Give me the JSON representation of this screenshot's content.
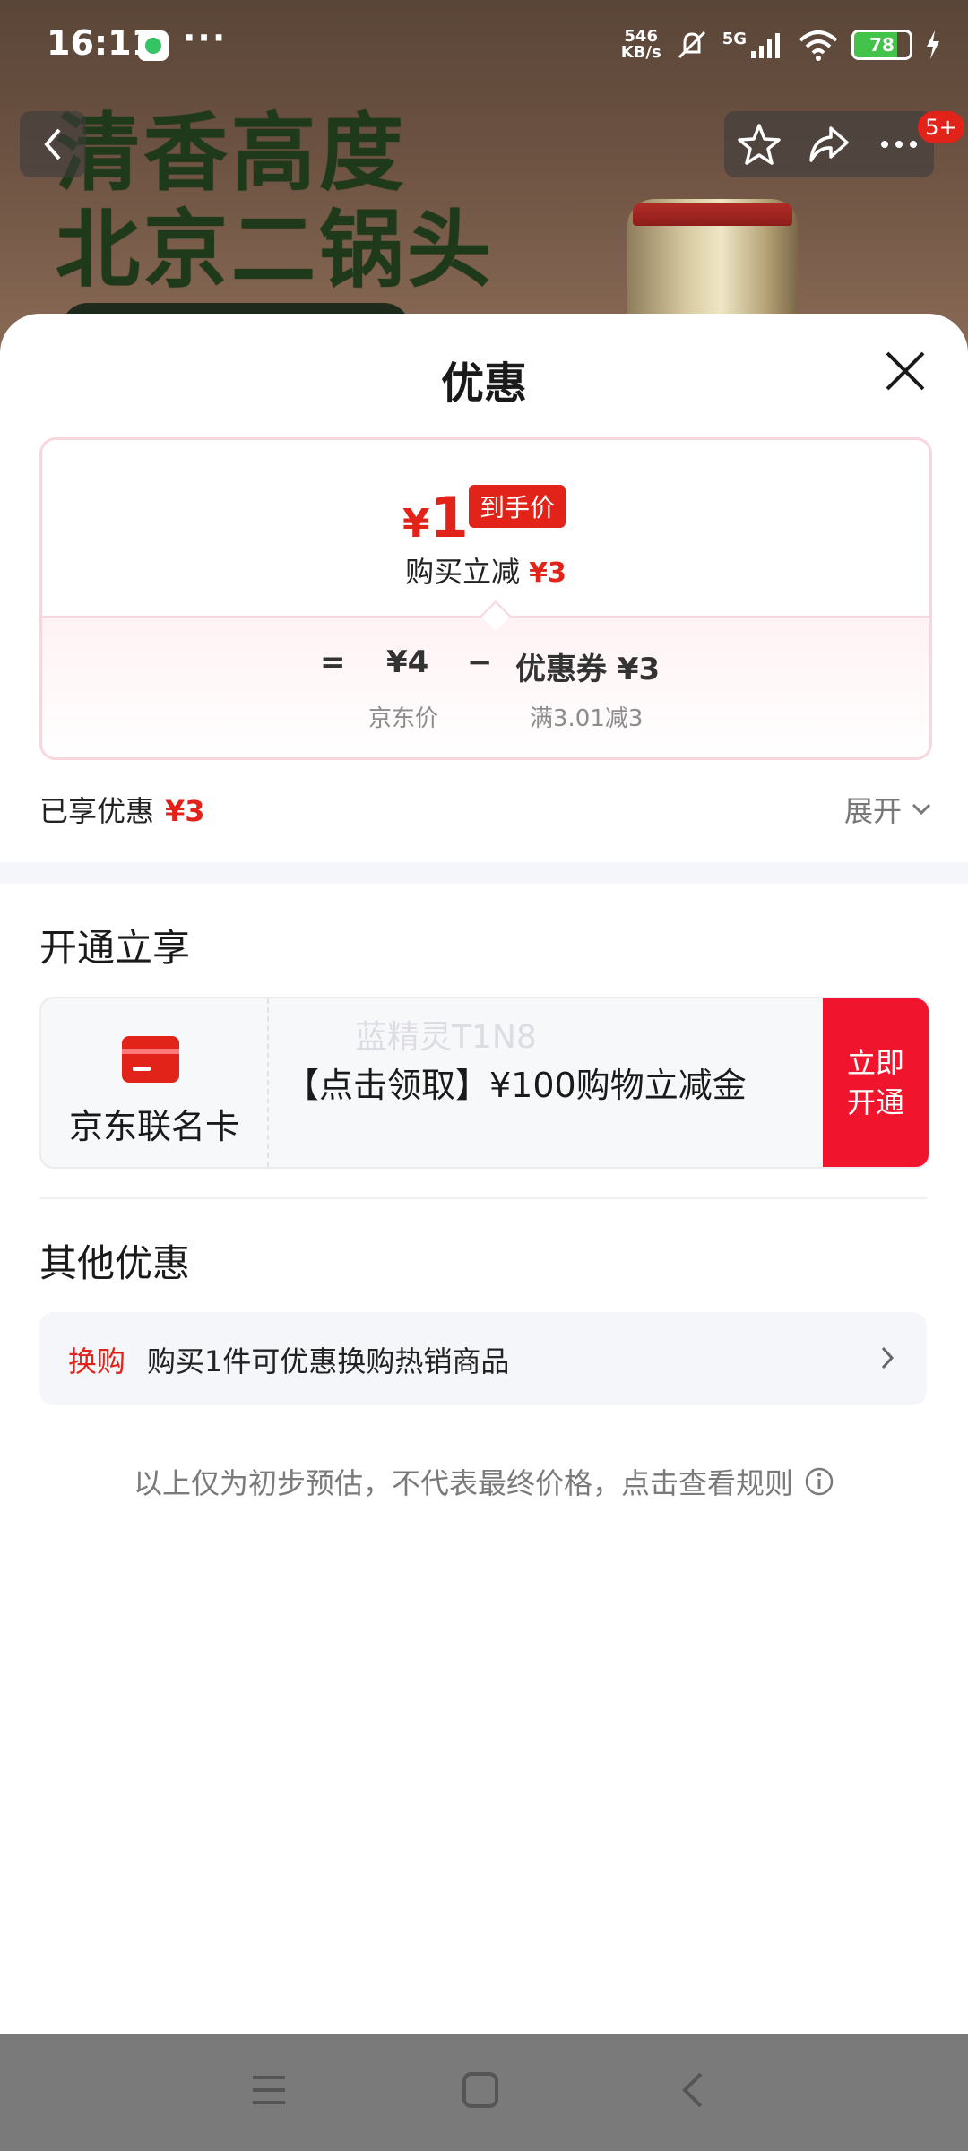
{
  "status_bar": {
    "time": "16:11",
    "more": "···",
    "net_speed_value": "546",
    "net_speed_unit": "KB/s",
    "signal": "5G",
    "battery": "78"
  },
  "hero": {
    "slogan_line1": "清香高度",
    "slogan_line2": "北京二锅头"
  },
  "nav": {
    "badge": "5+"
  },
  "sheet": {
    "title": "优惠",
    "price": {
      "currency": "¥",
      "final": "1",
      "final_tag": "到手价",
      "reduce_label": "购买立减",
      "reduce_amount": "¥3",
      "eq": "=",
      "jd_price": "¥4",
      "minus": "−",
      "coupon": "优惠券 ¥3",
      "jd_price_label": "京东价",
      "coupon_label": "满3.01减3"
    },
    "enjoyed_label": "已享优惠",
    "enjoyed_amount": "¥3",
    "expand_label": "展开",
    "open_section": {
      "title": "开通立享",
      "card_name": "京东联名卡",
      "watermark": "蓝精灵T1N8",
      "desc": "【点击领取】¥100购物立减金",
      "button_line1": "立即",
      "button_line2": "开通"
    },
    "other_section": {
      "title": "其他优惠",
      "tag": "换购",
      "text": "购买1件可优惠换购热销商品"
    },
    "disclaimer": "以上仅为初步预估，不代表最终价格，点击查看规则"
  },
  "colors": {
    "accent_red": "#e2231a",
    "button_red": "#f0142d"
  },
  "icons": [
    "back-icon",
    "star-icon",
    "share-icon",
    "more-icon",
    "close-icon",
    "chevron-down-icon",
    "card-icon",
    "chevron-right-icon",
    "info-icon",
    "menu-icon",
    "home-icon",
    "nav-back-icon"
  ]
}
